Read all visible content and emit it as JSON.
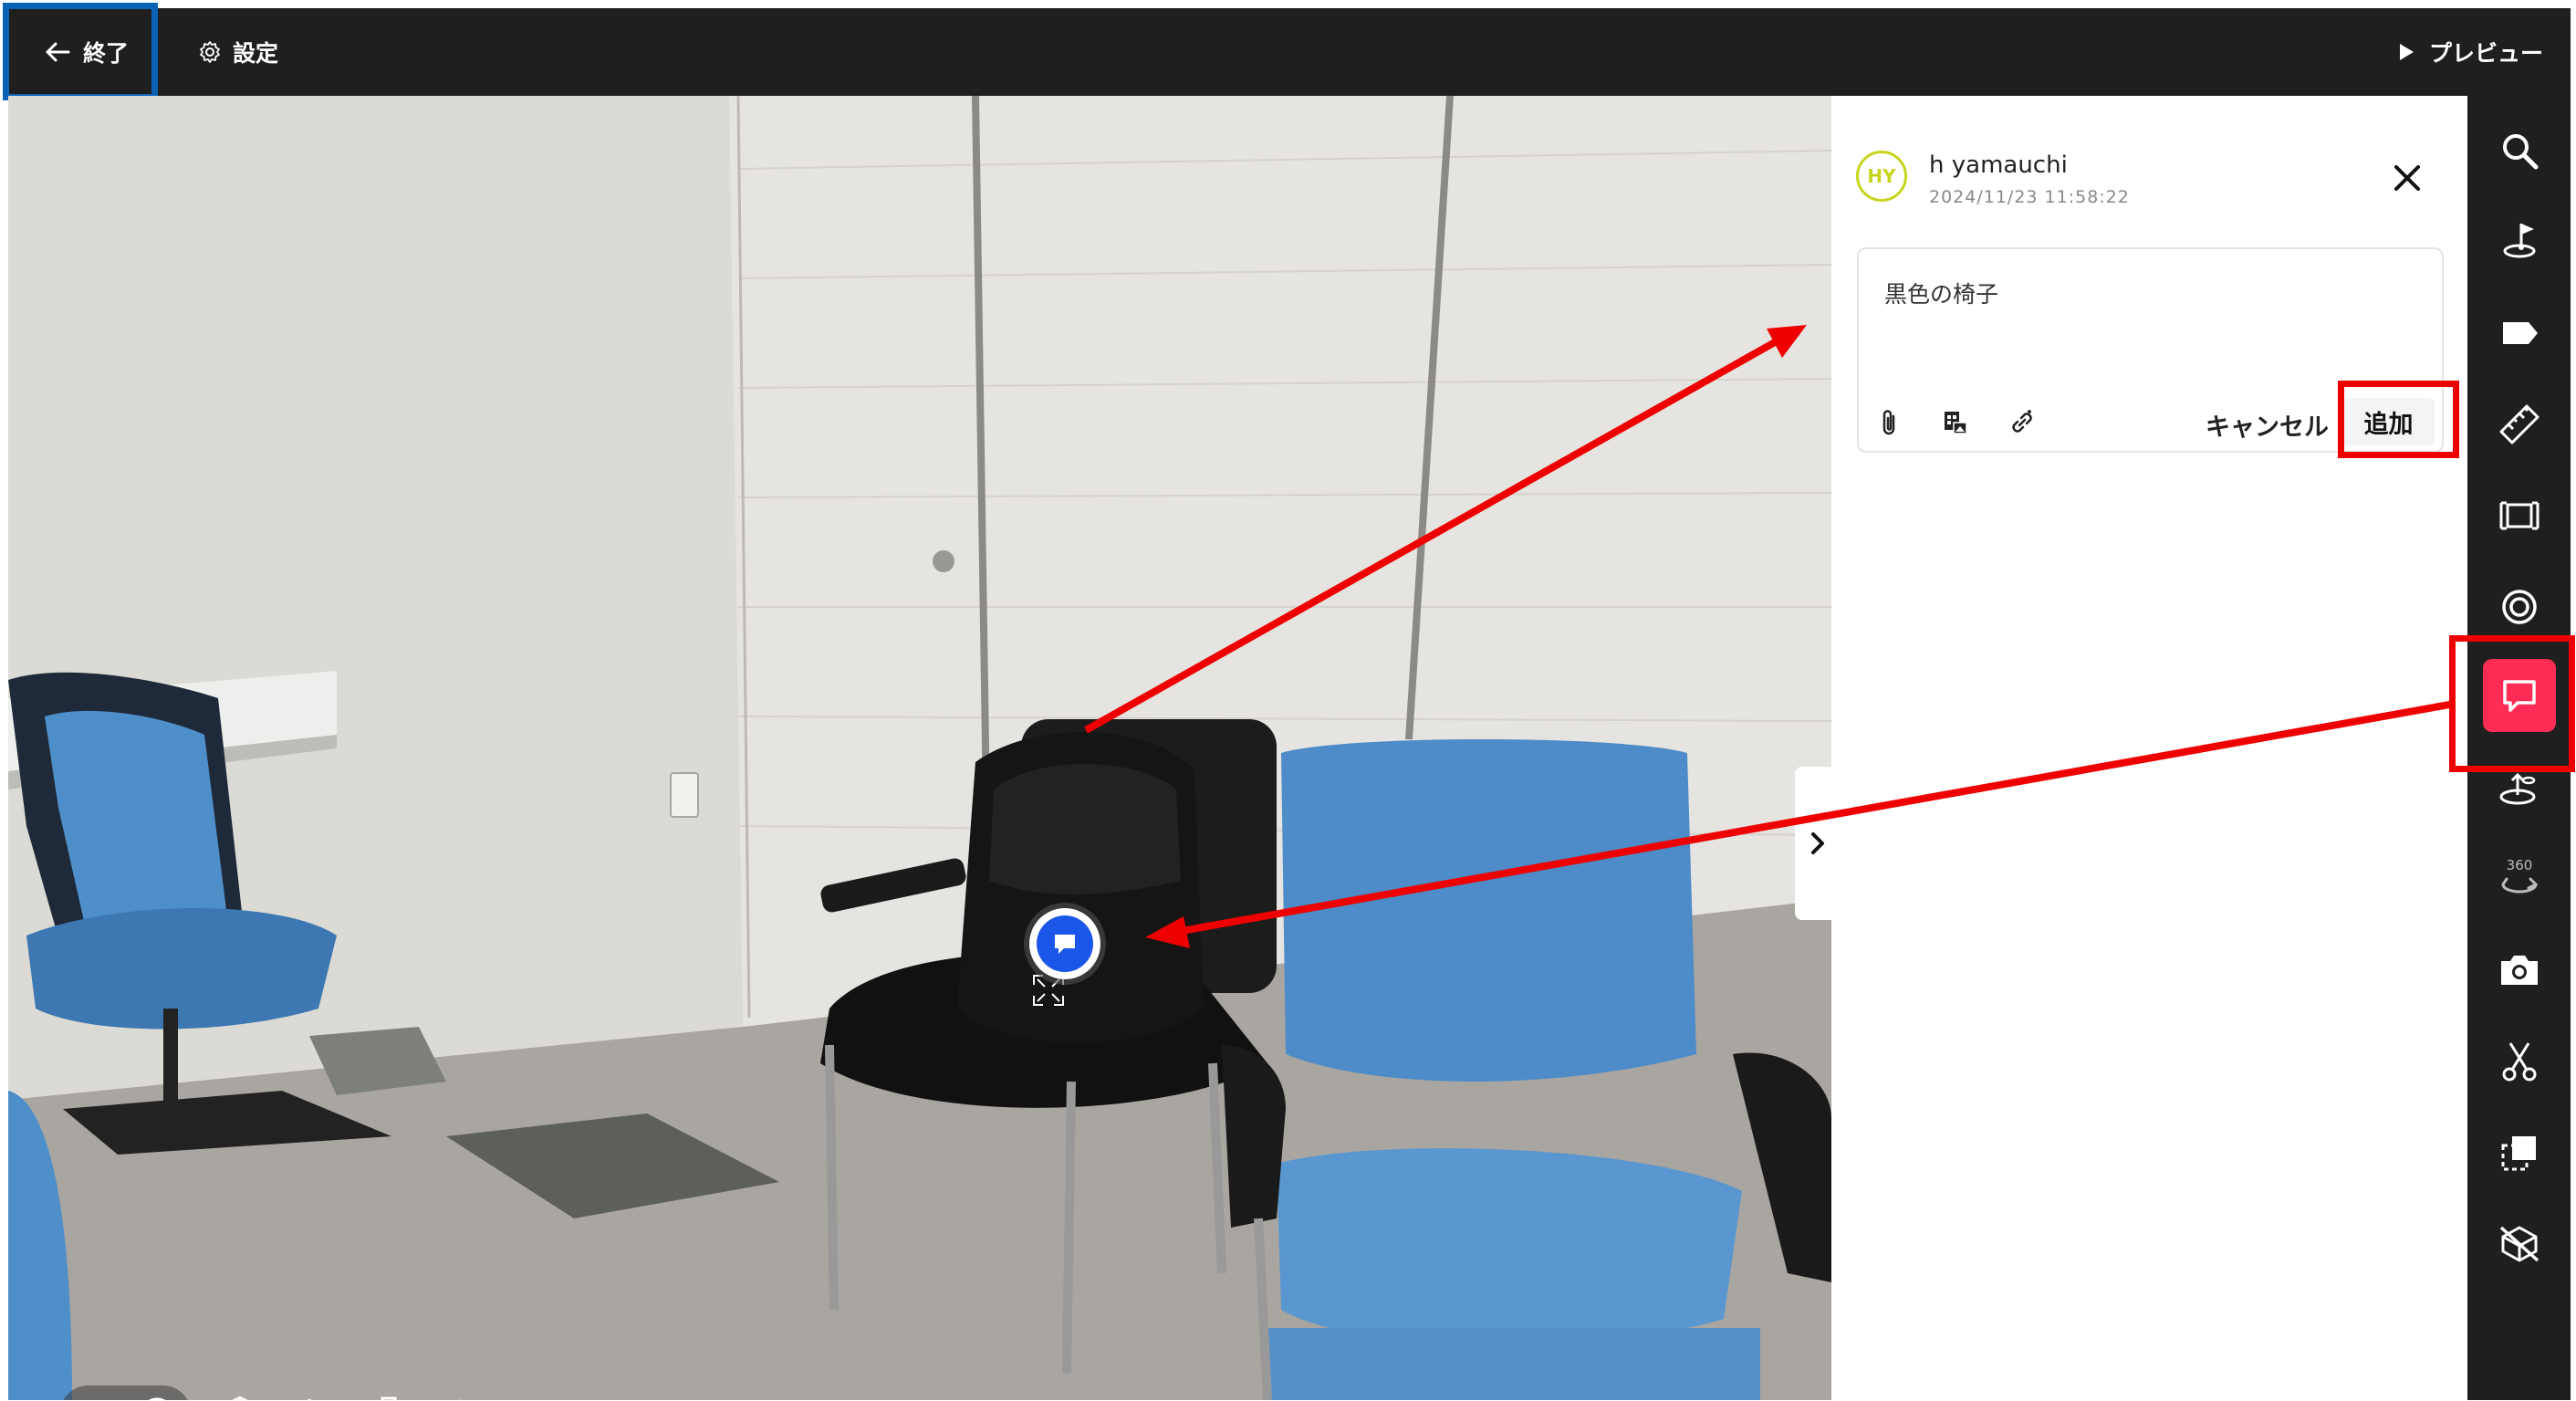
{
  "header": {
    "exit_label": "終了",
    "settings_label": "設定",
    "preview_label": "プレビュー"
  },
  "comment_panel": {
    "avatar_initials": "HY",
    "author_name": "h yamauchi",
    "timestamp": "2024/11/23 11:58:22",
    "comment_text": "黒色の椅子",
    "cancel_label": "キャンセル",
    "add_label": "追加",
    "tools": [
      "paperclip-icon",
      "image-icon",
      "link-icon"
    ]
  },
  "toolbar": {
    "items": [
      {
        "icon": "search-icon",
        "active": false
      },
      {
        "icon": "pin-marker-icon",
        "active": false
      },
      {
        "icon": "tag-icon",
        "active": false
      },
      {
        "icon": "ruler-icon",
        "active": false
      },
      {
        "icon": "area-measure-icon",
        "active": false
      },
      {
        "icon": "target-icon",
        "active": false
      },
      {
        "icon": "comment-icon",
        "active": true
      },
      {
        "icon": "floor-point-icon",
        "active": false
      },
      {
        "icon": "rotate-360-icon",
        "active": false,
        "label": "360"
      },
      {
        "icon": "camera-icon",
        "active": false
      },
      {
        "icon": "scissors-icon",
        "active": false
      },
      {
        "icon": "crop-select-icon",
        "active": false
      },
      {
        "icon": "hide-view-icon",
        "active": false
      }
    ]
  },
  "viewer": {
    "bottom_controls": [
      "chevron-up-icon",
      "play-icon",
      "dollhouse-icon",
      "floorplan-3d-icon",
      "floorplan-icon",
      "measure-mode-icon"
    ],
    "annotation_colors": {
      "highlight_red": "#ee0000",
      "highlight_blue": "#0b63b8",
      "active_tool": "#ff2d55",
      "marker": "#1a56e8"
    }
  }
}
